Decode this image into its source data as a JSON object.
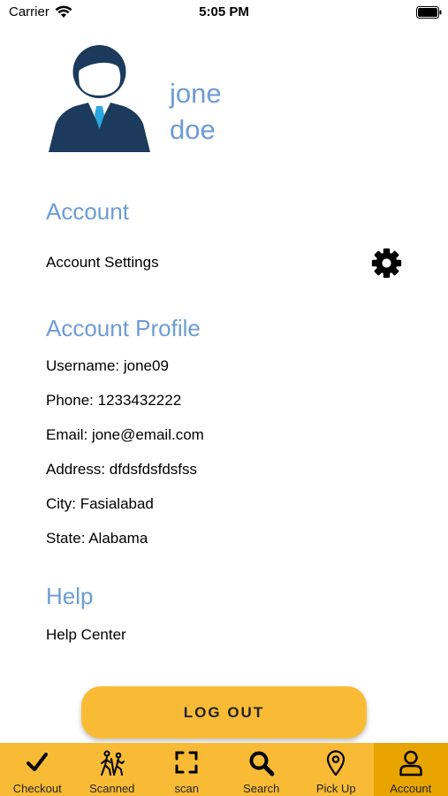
{
  "status_bar": {
    "carrier": "Carrier",
    "time": "5:05 PM"
  },
  "profile": {
    "name_line1": "jone",
    "name_line2": "doe"
  },
  "account": {
    "heading": "Account",
    "settings_label": "Account Settings"
  },
  "account_profile": {
    "heading": "Account Profile",
    "username": "Username: jone09",
    "phone": "Phone: 1233432222",
    "email": "Email: jone@email.com",
    "address": "Address: dfdsfdsfdsfss",
    "city": "City: Fasialabad",
    "state": "State: Alabama"
  },
  "help": {
    "heading": "Help",
    "center_label": "Help Center"
  },
  "logout": {
    "label": "LOG OUT"
  },
  "tabs": [
    {
      "label": "Checkout",
      "icon": "checkmark-icon"
    },
    {
      "label": "Scanned",
      "icon": "hikers-icon"
    },
    {
      "label": "scan",
      "icon": "scan-frame-icon"
    },
    {
      "label": "Search",
      "icon": "search-icon"
    },
    {
      "label": "Pick Up",
      "icon": "location-pin-icon"
    },
    {
      "label": "Account",
      "icon": "user-icon"
    }
  ],
  "colors": {
    "accent": "#6d9cd6",
    "tabbar": "#f9bb36",
    "tab_active": "#e8a400",
    "avatar_dark": "#1b3a5c",
    "tie": "#29a6e0"
  }
}
